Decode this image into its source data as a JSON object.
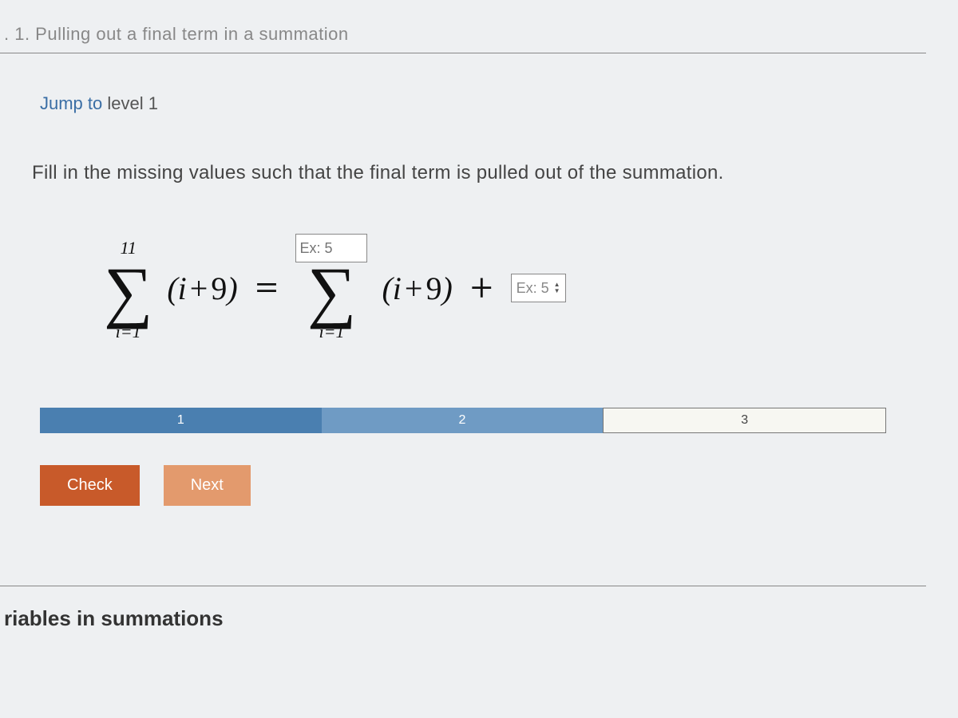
{
  "header_fragment": ". 1. Pulling out a final term in a summation",
  "jump_link": {
    "prefix": "Jump to",
    "label": "level 1"
  },
  "prompt": "Fill in the missing values such that the final term is pulled out of the summation.",
  "equation": {
    "lhs_upper": "11",
    "lhs_lower": "i=1",
    "lhs_term_var": "i",
    "lhs_term_plus": "+",
    "lhs_term_const": "9",
    "eq": "=",
    "rhs_upper_placeholder": "Ex: 5",
    "rhs_lower": "i=1",
    "rhs_term_var": "i",
    "rhs_term_plus": "+",
    "rhs_term_const": "9",
    "plus": "+",
    "tail_placeholder": "Ex: 5"
  },
  "progress": {
    "seg1": "1",
    "seg2": "2",
    "seg3": "3"
  },
  "buttons": {
    "check": "Check",
    "next": "Next"
  },
  "footer_heading": "riables in summations"
}
